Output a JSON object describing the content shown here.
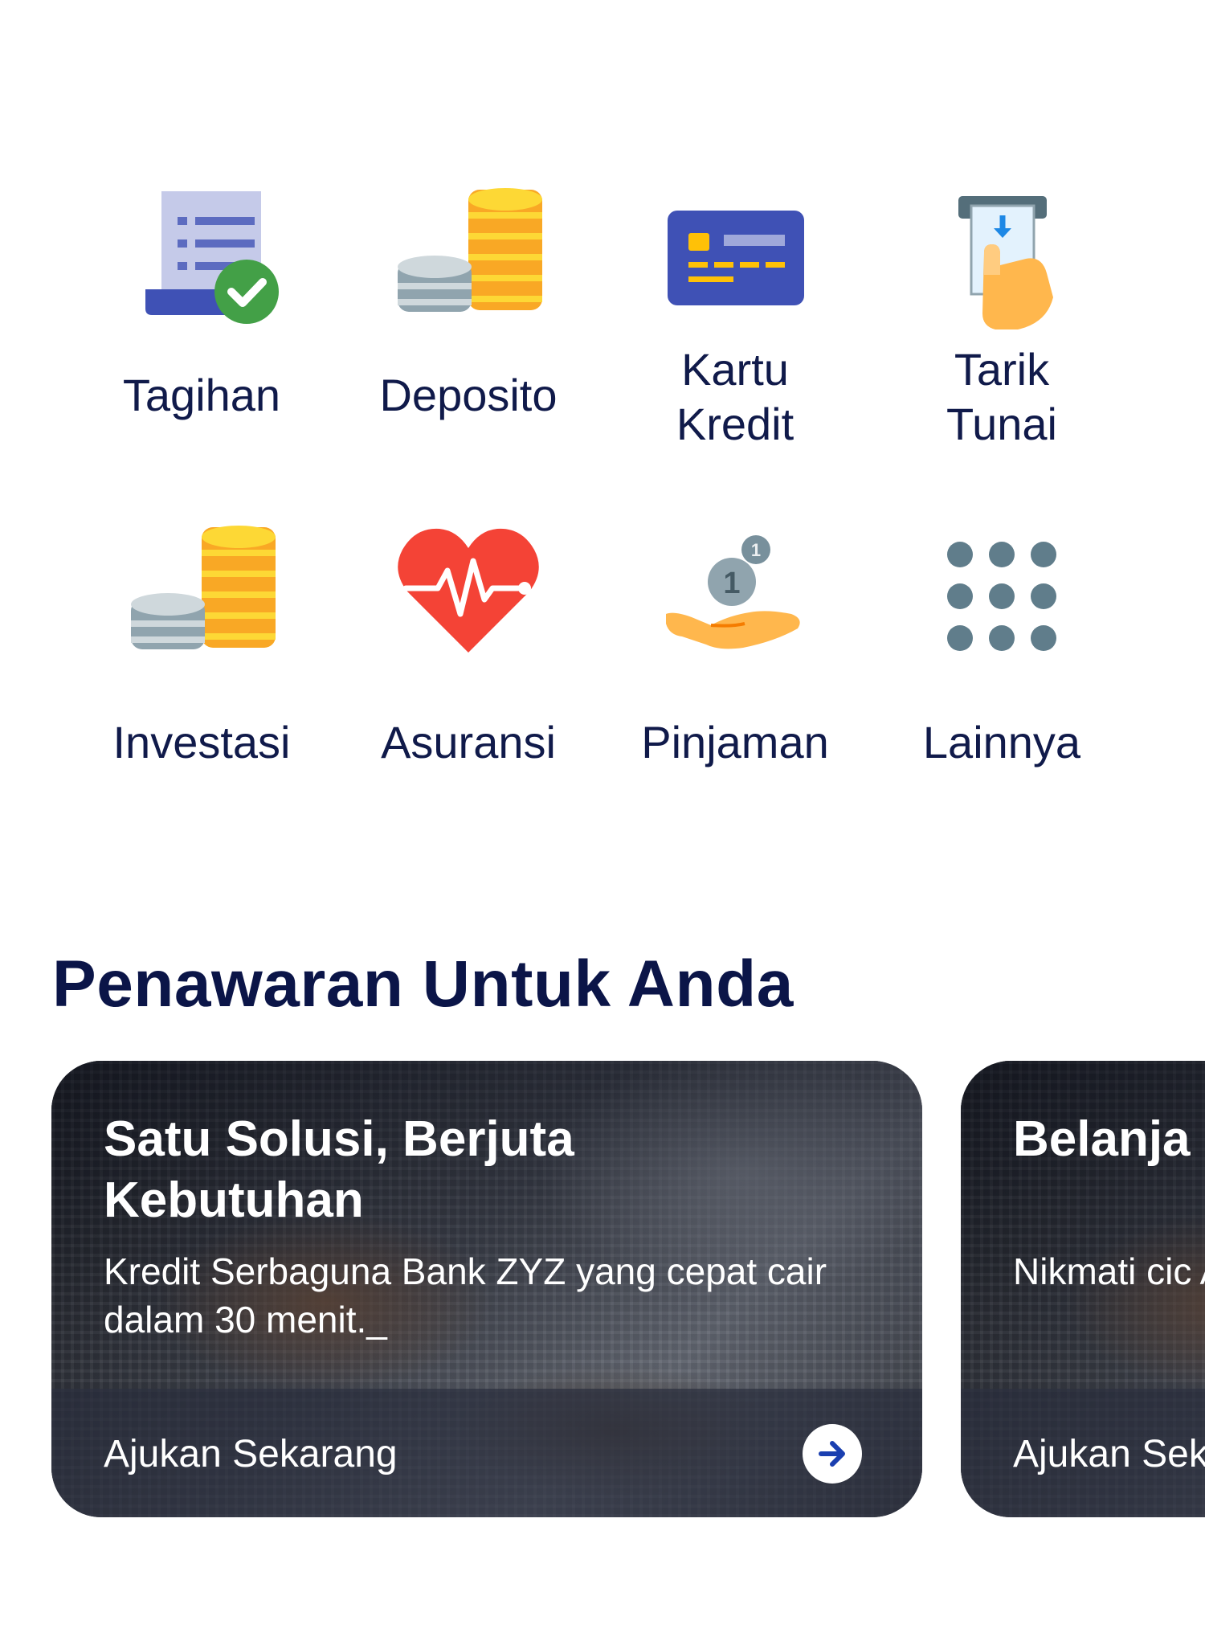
{
  "menu": {
    "items": [
      {
        "label": "Tagihan",
        "icon": "bill-check-icon"
      },
      {
        "label": "Deposito",
        "icon": "coins-stack-icon"
      },
      {
        "label": "Kartu\nKredit",
        "icon": "credit-card-icon"
      },
      {
        "label": "Tarik\nTunai",
        "icon": "atm-withdraw-icon"
      },
      {
        "label": "Investasi",
        "icon": "coins-stack-icon"
      },
      {
        "label": "Asuransi",
        "icon": "heart-pulse-icon"
      },
      {
        "label": "Pinjaman",
        "icon": "hand-coins-icon"
      },
      {
        "label": "Lainnya",
        "icon": "grid-dots-icon"
      }
    ]
  },
  "offers": {
    "title": "Penawaran Untuk Anda",
    "cards": [
      {
        "title": "Satu Solusi, Berjuta Kebutuhan",
        "description": "Kredit Serbaguna Bank ZYZ yang cepat cair dalam 30 menit._",
        "cta": "Ajukan Sekarang"
      },
      {
        "title": "Belanja Kredit",
        "description": "Nikmati cic Anda, kapa",
        "cta": "Ajukan Sek"
      }
    ]
  },
  "colors": {
    "text_primary": "#0b1548",
    "icon_blue": "#3f4fb5",
    "icon_gold": "#fbc02d",
    "icon_red": "#f44336",
    "icon_green": "#43a047",
    "icon_grey": "#607d8b"
  }
}
